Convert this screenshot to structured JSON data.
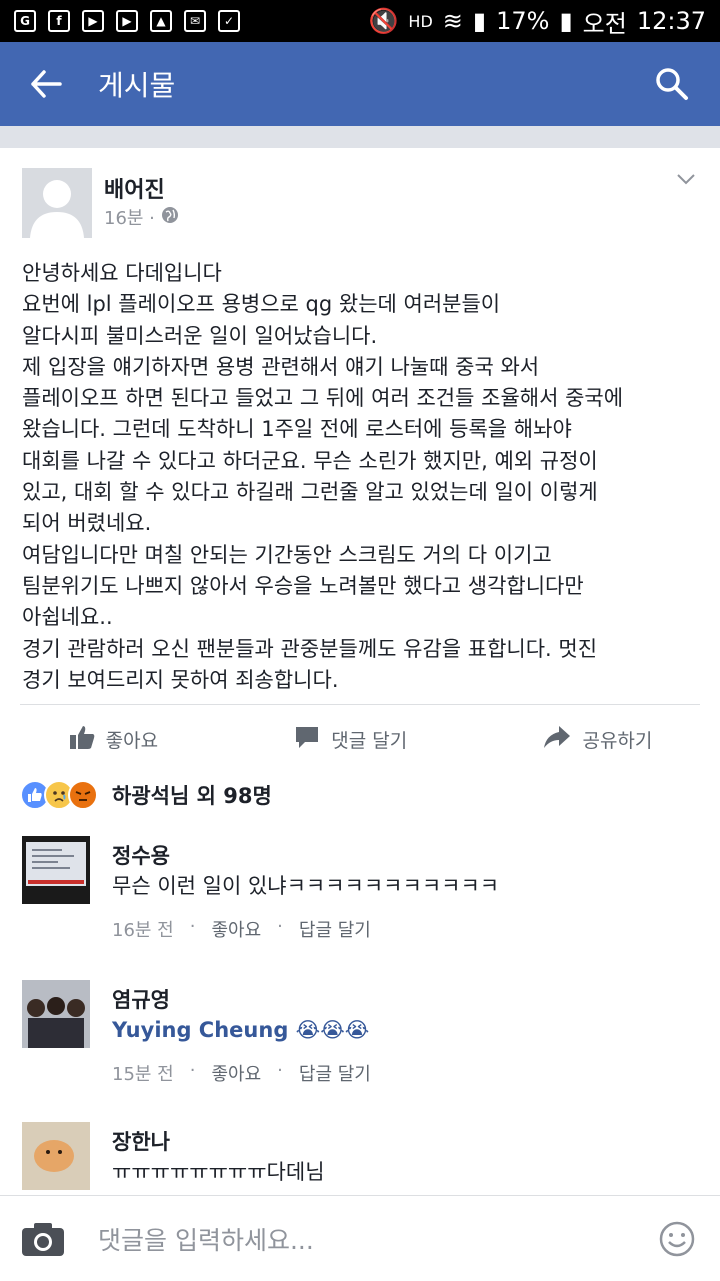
{
  "status_bar": {
    "battery": "17%",
    "ampm": "오전",
    "time": "12:37",
    "hd": "HD"
  },
  "app_bar": {
    "title": "게시물"
  },
  "post": {
    "author": "배어진",
    "time": "16분 ·",
    "lines": [
      "안녕하세요 다데입니다",
      "요번에 lpl 플레이오프 용병으로 qg 왔는데 여러분들이",
      "알다시피 불미스러운 일이 일어났습니다.",
      "제 입장을 얘기하자면 용병 관련해서 얘기 나눌때 중국 와서",
      "플레이오프 하면 된다고 들었고 그 뒤에 여러 조건들 조율해서 중국에",
      "왔습니다. 그런데 도착하니 1주일 전에 로스터에 등록을 해놔야",
      "대회를 나갈 수 있다고 하더군요. 무슨 소린가 했지만, 예외 규정이",
      "있고, 대회 할 수 있다고 하길래 그런줄 알고 있었는데 일이 이렇게",
      "되어 버렸네요.",
      "여담입니다만 며칠 안되는 기간동안 스크림도 거의 다 이기고",
      "팀분위기도 나쁘지 않아서 우승을 노려볼만 했다고 생각합니다만",
      "아쉽네요..",
      "경기 관람하러 오신 팬분들과 관중분들께도 유감을 표합니다. 멋진",
      "경기 보여드리지 못하여 죄송합니다."
    ],
    "actions": {
      "like": "좋아요",
      "comment": "댓글 달기",
      "share": "공유하기"
    },
    "reactions_text": "하광석님 외 98명"
  },
  "comments": [
    {
      "name": "정수용",
      "text": "무슨 이런 일이 있냐ㅋㅋㅋㅋㅋㅋㅋㅋㅋㅋㅋ",
      "time": "16분 전",
      "like": "좋아요",
      "reply": "답글 달기"
    },
    {
      "name": "염규영",
      "text": "Yuying Cheung",
      "emoji": "😭😭😭",
      "time": "15분 전",
      "like": "좋아요",
      "reply": "답글 달기"
    },
    {
      "name": "장한나",
      "text": "ㅠㅠㅠㅠㅠㅠㅠㅠ다데님"
    }
  ],
  "composer": {
    "placeholder": "댓글을 입력하세요..."
  },
  "colors": {
    "brand": "#4267b2",
    "like": "#5890ff",
    "angry": "#e9710f"
  }
}
